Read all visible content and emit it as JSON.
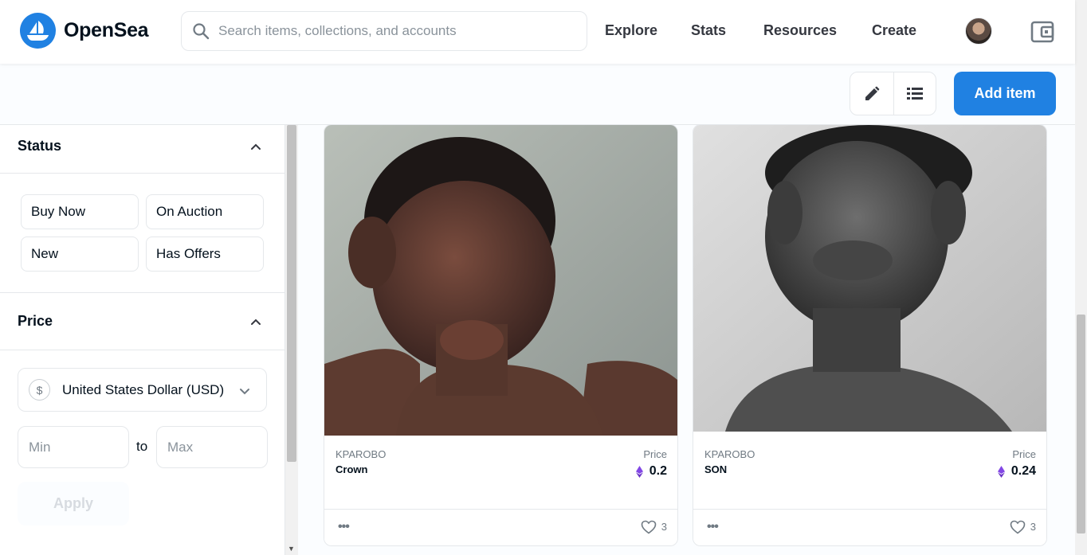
{
  "header": {
    "logo_text": "OpenSea",
    "search_placeholder": "Search items, collections, and accounts",
    "nav": [
      "Explore",
      "Stats",
      "Resources",
      "Create"
    ]
  },
  "toolbar": {
    "add_item_label": "Add item"
  },
  "sidebar": {
    "status": {
      "title": "Status",
      "buttons": [
        "Buy Now",
        "On Auction",
        "New",
        "Has Offers"
      ]
    },
    "price": {
      "title": "Price",
      "currency": "United States Dollar (USD)",
      "currency_symbol": "$",
      "min_placeholder": "Min",
      "to_label": "to",
      "max_placeholder": "Max",
      "apply_label": "Apply"
    }
  },
  "cards": [
    {
      "collection": "KPAROBO",
      "name": "Crown",
      "price_label": "Price",
      "price": "0.2",
      "likes": "3"
    },
    {
      "collection": "KPAROBO",
      "name": "SON",
      "price_label": "Price",
      "price": "0.24",
      "likes": "3"
    }
  ],
  "colors": {
    "accent": "#2081e2",
    "eth": "#8247e5"
  }
}
